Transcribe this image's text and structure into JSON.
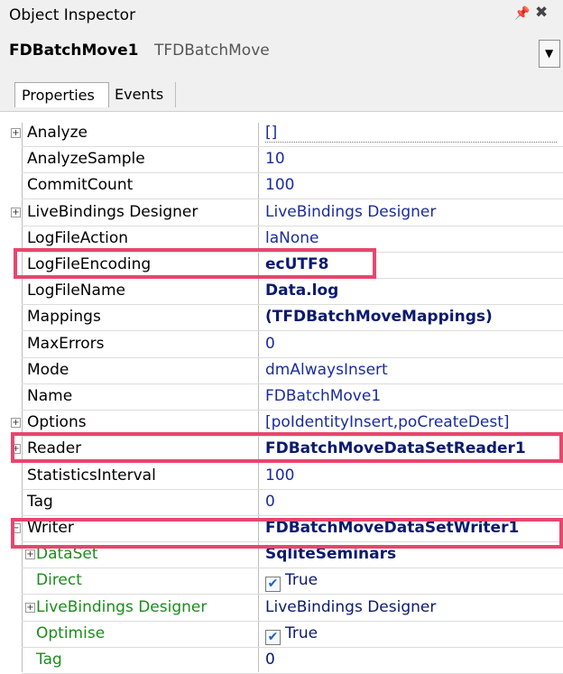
{
  "titlebar": {
    "title": "Object Inspector",
    "pin_glyph": "#",
    "close_glyph": "✖"
  },
  "component": {
    "name": "FDBatchMove1",
    "type": "TFDBatchMove",
    "dropdown_glyph": "▼"
  },
  "tabs": [
    {
      "label": "Properties",
      "active": true
    },
    {
      "label": "Events",
      "active": false
    }
  ],
  "properties": [
    {
      "name": "Analyze",
      "value": "[]",
      "expander": "plus",
      "bold": false
    },
    {
      "name": "AnalyzeSample",
      "value": "10",
      "bold": false
    },
    {
      "name": "CommitCount",
      "value": "100",
      "bold": false
    },
    {
      "name": "LiveBindings Designer",
      "value": "LiveBindings Designer",
      "expander": "plus",
      "bold": false
    },
    {
      "name": "LogFileAction",
      "value": "laNone",
      "bold": false
    },
    {
      "name": "LogFileEncoding",
      "value": "ecUTF8",
      "bold": true,
      "highlight": true
    },
    {
      "name": "LogFileName",
      "value": "Data.log",
      "bold": true
    },
    {
      "name": "Mappings",
      "value": "(TFDBatchMoveMappings)",
      "bold": true
    },
    {
      "name": "MaxErrors",
      "value": "0",
      "bold": false
    },
    {
      "name": "Mode",
      "value": "dmAlwaysInsert",
      "bold": false
    },
    {
      "name": "Name",
      "value": "FDBatchMove1",
      "bold": false
    },
    {
      "name": "Options",
      "value": "[poIdentityInsert,poCreateDest]",
      "expander": "plus",
      "bold": false
    },
    {
      "name": "Reader",
      "value": "FDBatchMoveDataSetReader1",
      "expander": "plus",
      "bold": true,
      "highlight": true
    },
    {
      "name": "StatisticsInterval",
      "value": "100",
      "bold": false
    },
    {
      "name": "Tag",
      "value": "0",
      "bold": false
    },
    {
      "name": "Writer",
      "value": "FDBatchMoveDataSetWriter1",
      "expander": "minus",
      "bold": true,
      "highlight": true
    },
    {
      "name": "DataSet",
      "value": "SqliteSeminars",
      "expander": "plus",
      "bold": true,
      "child": true
    },
    {
      "name": "Direct",
      "value": "True",
      "checkbox": true,
      "child": true
    },
    {
      "name": "LiveBindings Designer",
      "value": "LiveBindings Designer",
      "expander": "plus",
      "child": true
    },
    {
      "name": "Optimise",
      "value": "True",
      "checkbox": true,
      "child": true
    },
    {
      "name": "Tag",
      "value": "0",
      "child": true
    }
  ],
  "colors": {
    "highlight_border": "#e8466e",
    "value_blue": "#1a2c9c",
    "child_name_green": "#1c8c1c"
  }
}
